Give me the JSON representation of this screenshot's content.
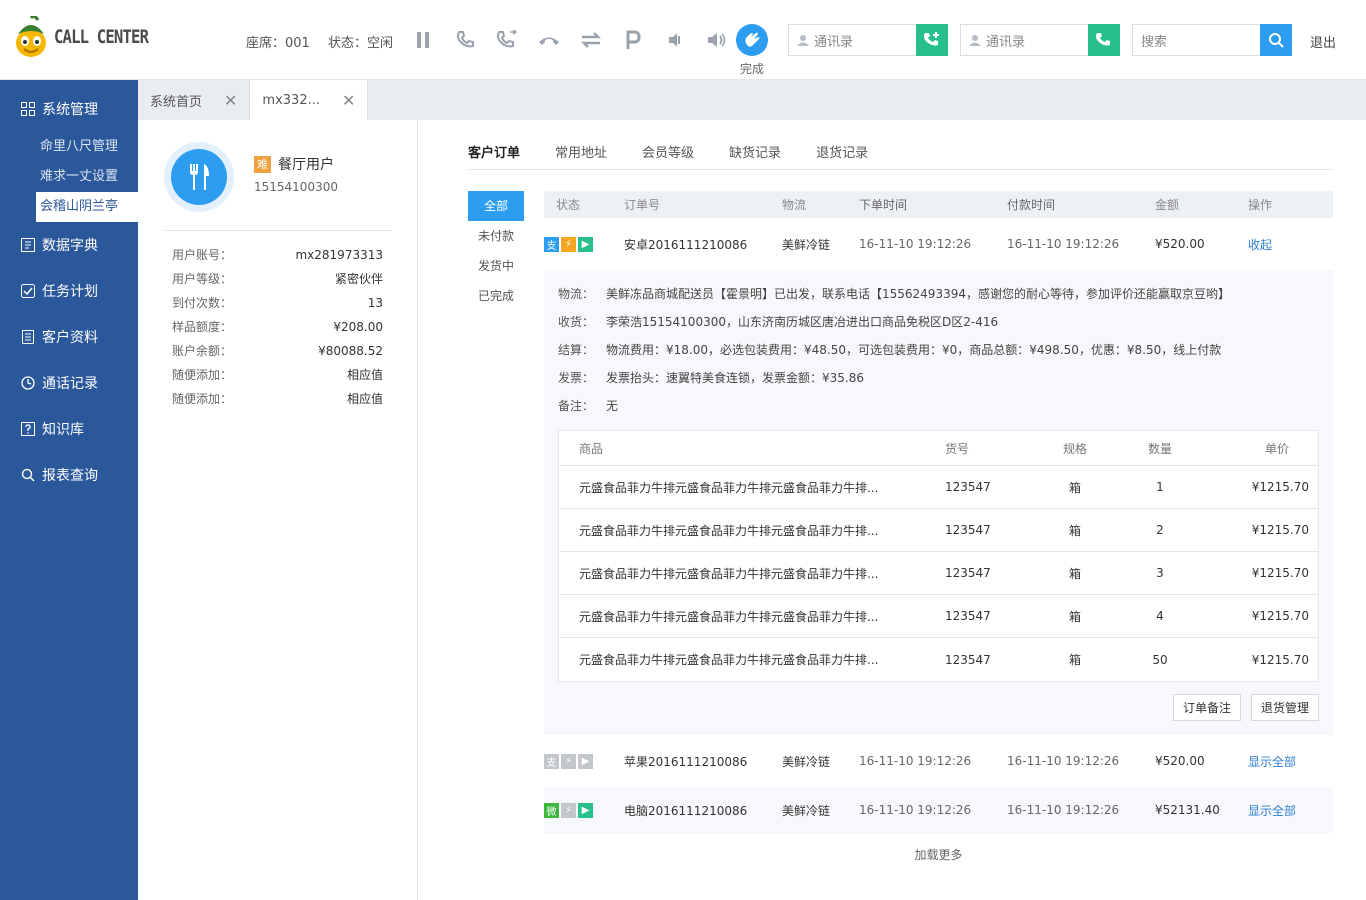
{
  "app": {
    "logo_text": "CALL CENTER"
  },
  "header": {
    "seat": "座席：001",
    "status": "状态：空闲",
    "done_label": "完成",
    "contact1_placeholder": "通讯录",
    "contact2_placeholder": "通讯录",
    "search_placeholder": "搜索",
    "logout": "退出"
  },
  "sidebar": {
    "items": [
      {
        "label": "系统管理",
        "icon": "grid-icon"
      },
      {
        "label": "数据字典",
        "icon": "dictionary-icon"
      },
      {
        "label": "任务计划",
        "icon": "task-icon"
      },
      {
        "label": "客户资料",
        "icon": "document-icon"
      },
      {
        "label": "通话记录",
        "icon": "clock-icon"
      },
      {
        "label": "知识库",
        "icon": "help-icon"
      },
      {
        "label": "报表查询",
        "icon": "search-icon"
      }
    ],
    "subitems": [
      "命里八尺管理",
      "难求一丈设置",
      "会稽山阴兰亭"
    ]
  },
  "tabs": [
    {
      "label": "系统首页"
    },
    {
      "label": "mx332..."
    }
  ],
  "profile": {
    "badge": "难",
    "name": "餐厅用户",
    "phone": "15154100300",
    "fields": [
      {
        "k": "用户账号：",
        "v": "mx281973313"
      },
      {
        "k": "用户等级：",
        "v": "紧密伙伴"
      },
      {
        "k": "到付次数：",
        "v": "13"
      },
      {
        "k": "样品额度：",
        "v": "¥208.00"
      },
      {
        "k": "账户余额：",
        "v": "¥80088.52"
      },
      {
        "k": "随便添加：",
        "v": "相应值"
      },
      {
        "k": "随便添加：",
        "v": "相应值"
      }
    ]
  },
  "content_tabs": [
    "客户订单",
    "常用地址",
    "会员等级",
    "缺货记录",
    "退货记录"
  ],
  "filters": [
    "全部",
    "未付款",
    "发货中",
    "已完成"
  ],
  "orders": {
    "headers": {
      "status": "状态",
      "no": "订单号",
      "logistics": "物流",
      "order_time": "下单时间",
      "pay_time": "付款时间",
      "amount": "金额",
      "op": "操作"
    },
    "rows": [
      {
        "icons": [
          "支",
          "⚡",
          "▶"
        ],
        "icon_colors": [
          "#2c9df0",
          "#f5a623",
          "#27c08a"
        ],
        "no": "安卓2016111210086",
        "logistics": "美鲜冷链",
        "order_time": "16-11-10 19:12:26",
        "pay_time": "16-11-10 19:12:26",
        "amount": "¥520.00",
        "op": "收起"
      },
      {
        "icons": [
          "支",
          "⚡",
          "▶"
        ],
        "icon_colors": [
          "#c3c7cc",
          "#c3c7cc",
          "#c3c7cc"
        ],
        "no": "苹果2016111210086",
        "logistics": "美鲜冷链",
        "order_time": "16-11-10 19:12:26",
        "pay_time": "16-11-10 19:12:26",
        "amount": "¥520.00",
        "op": "显示全部"
      },
      {
        "icons": [
          "微",
          "⚡",
          "▶"
        ],
        "icon_colors": [
          "#3cb83c",
          "#c3c7cc",
          "#27c08a"
        ],
        "no": "电脑2016111210086",
        "logistics": "美鲜冷链",
        "order_time": "16-11-10 19:12:26",
        "pay_time": "16-11-10 19:12:26",
        "amount": "¥52131.40",
        "op": "显示全部"
      }
    ],
    "detail": {
      "lines": [
        {
          "k": "物流：",
          "v": "美鲜冻品商城配送员【霍景明】已出发，联系电话【15562493394，感谢您的耐心等待，参加评价还能赢取京豆哟】"
        },
        {
          "k": "收货：",
          "v": "李荣浩15154100300，山东济南历城区唐冶进出口商品免税区D区2-416"
        },
        {
          "k": "结算：",
          "v": "物流费用：¥18.00，必选包装费用：¥48.50，可选包装费用：¥0，商品总额：¥498.50，优惠：¥8.50，线上付款"
        },
        {
          "k": "发票：",
          "v": "发票抬头：速翼特美食连锁，发票金额：¥35.86"
        },
        {
          "k": "备注：",
          "v": "无"
        }
      ],
      "item_headers": {
        "name": "商品",
        "no": "货号",
        "spec": "规格",
        "qty": "数量",
        "price": "单价"
      },
      "items": [
        {
          "name": "元盛食品菲力牛排元盛食品菲力牛排元盛食品菲力牛排...",
          "no": "123547",
          "spec": "箱",
          "qty": "1",
          "price": "¥1215.70"
        },
        {
          "name": "元盛食品菲力牛排元盛食品菲力牛排元盛食品菲力牛排...",
          "no": "123547",
          "spec": "箱",
          "qty": "2",
          "price": "¥1215.70"
        },
        {
          "name": "元盛食品菲力牛排元盛食品菲力牛排元盛食品菲力牛排...",
          "no": "123547",
          "spec": "箱",
          "qty": "3",
          "price": "¥1215.70"
        },
        {
          "name": "元盛食品菲力牛排元盛食品菲力牛排元盛食品菲力牛排...",
          "no": "123547",
          "spec": "箱",
          "qty": "4",
          "price": "¥1215.70"
        },
        {
          "name": "元盛食品菲力牛排元盛食品菲力牛排元盛食品菲力牛排...",
          "no": "123547",
          "spec": "箱",
          "qty": "50",
          "price": "¥1215.70"
        }
      ],
      "buttons": [
        "订单备注",
        "退货管理"
      ]
    },
    "load_more": "加载更多"
  },
  "colors": {
    "sidebar": "#2b579b",
    "accent": "#2c9df0",
    "green": "#27c08a"
  }
}
